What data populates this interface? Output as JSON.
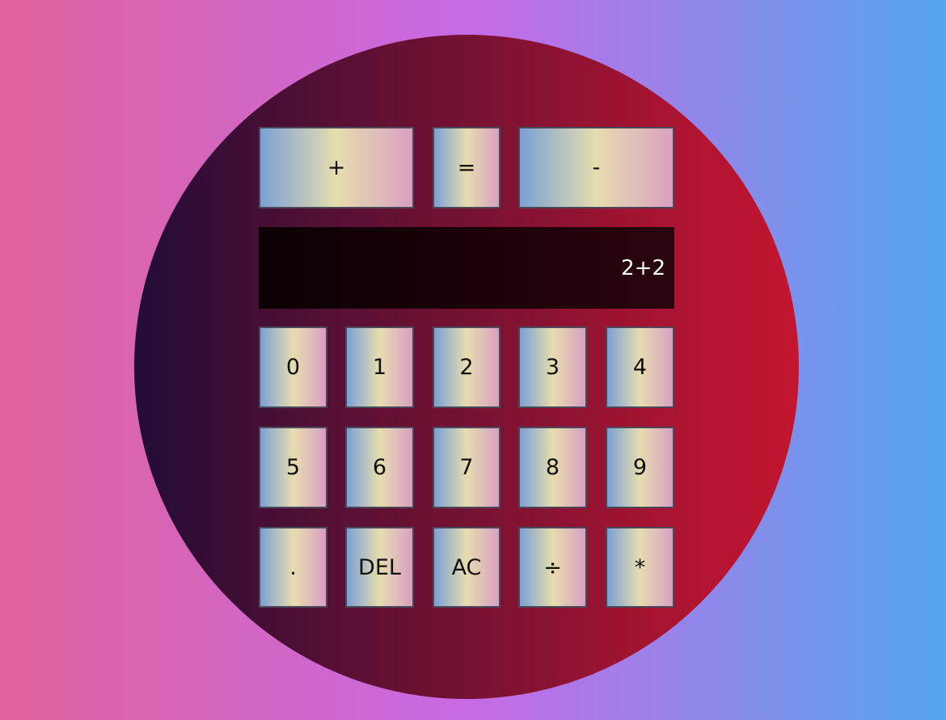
{
  "display": {
    "value": "2+2"
  },
  "top_row": {
    "plus": "+",
    "equals": "=",
    "minus": "-"
  },
  "keys": {
    "k0": "0",
    "k1": "1",
    "k2": "2",
    "k3": "3",
    "k4": "4",
    "k5": "5",
    "k6": "6",
    "k7": "7",
    "k8": "8",
    "k9": "9",
    "dot": ".",
    "del": "DEL",
    "ac": "AC",
    "divide": "÷",
    "multiply": "*"
  },
  "colors": {
    "bg_left": "#e0619b",
    "bg_mid": "#c76ae6",
    "bg_right": "#55a6ee",
    "circle_left": "#220c37",
    "circle_right": "#c31530",
    "key_left": "#7aa1d4",
    "key_mid": "#e7ddaf",
    "key_right": "#d9a0c2",
    "display_bg": "#1b0007",
    "display_text": "#ffffff"
  }
}
